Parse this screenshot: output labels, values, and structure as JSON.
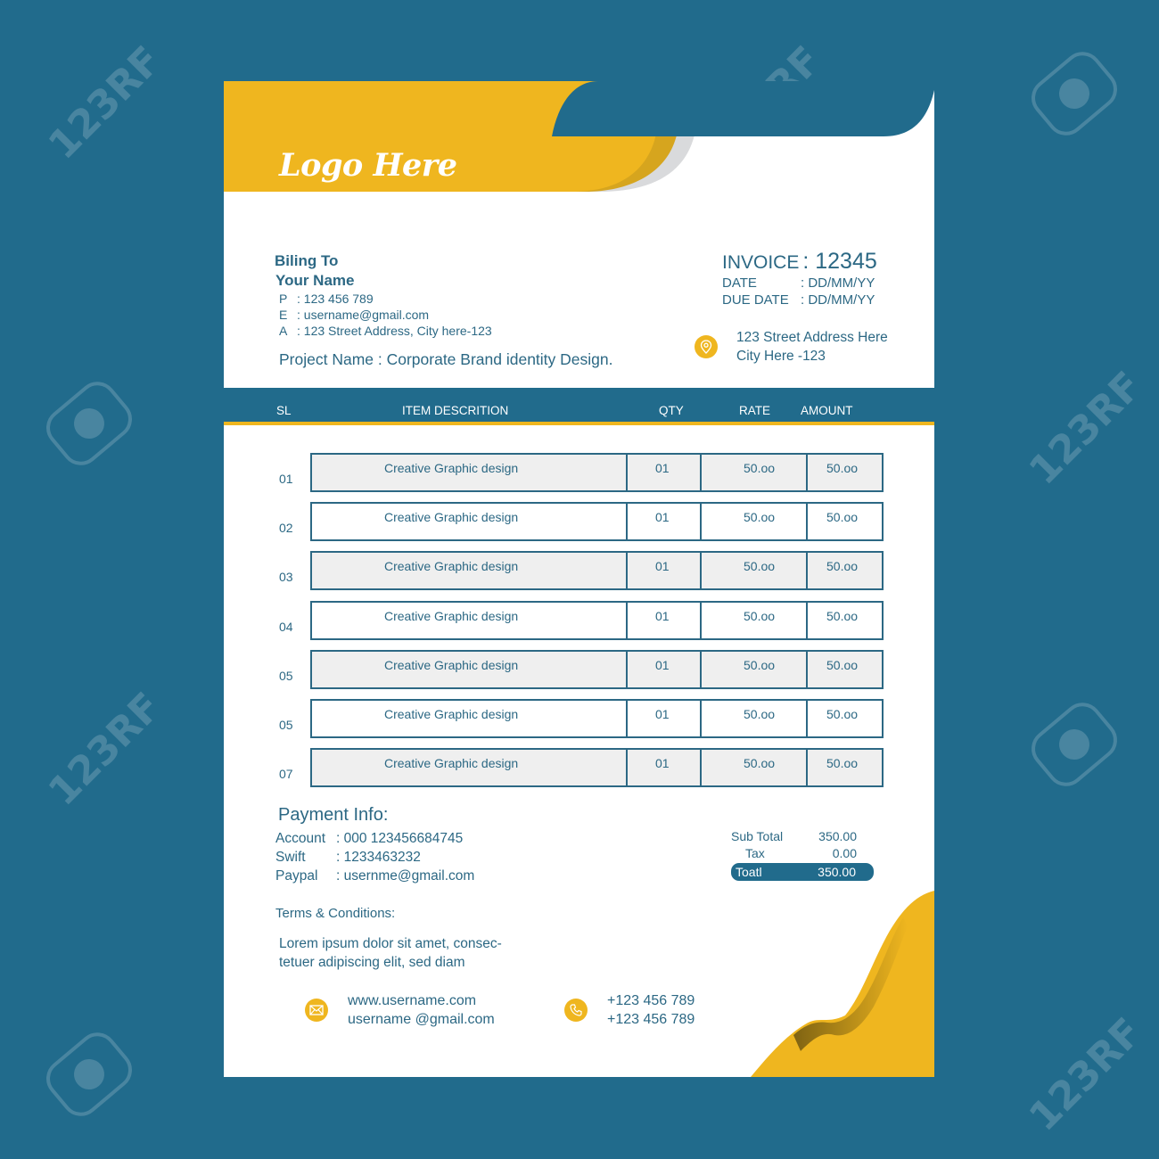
{
  "colors": {
    "primary": "#216b8c",
    "accent": "#efb61f",
    "text": "#2c6884",
    "row_shade": "#efefef"
  },
  "watermark": "123RF",
  "header": {
    "logo_text": "Logo Here"
  },
  "billing": {
    "heading": "Biling To",
    "name": "Your Name",
    "fields": [
      {
        "key": "P",
        "value": ": 123 456 789"
      },
      {
        "key": "E",
        "value": ":  username@gmail.com"
      },
      {
        "key": "A",
        "value": ": 123 Street Address, City here-123"
      }
    ],
    "project": "Project Name : Corporate Brand identity Design."
  },
  "invoice": {
    "label": "INVOICE",
    "number": ": 12345",
    "date_label": "DATE",
    "date_value": ": DD/MM/YY",
    "due_label": "DUE DATE",
    "due_value": ": DD/MM/YY"
  },
  "company_address": {
    "icon": "location-pin-icon",
    "line1": "123 Street Address Here",
    "line2": "City Here -123"
  },
  "table": {
    "headers": {
      "sl": "SL",
      "description": "ITEM DESCRITION",
      "qty": "QTY",
      "rate": "RATE",
      "amount": "AMOUNT"
    },
    "rows": [
      {
        "sl": "01",
        "description": "Creative Graphic design",
        "qty": "01",
        "rate": "50.oo",
        "amount": "50.oo"
      },
      {
        "sl": "02",
        "description": "Creative Graphic design",
        "qty": "01",
        "rate": "50.oo",
        "amount": "50.oo"
      },
      {
        "sl": "03",
        "description": "Creative Graphic design",
        "qty": "01",
        "rate": "50.oo",
        "amount": "50.oo"
      },
      {
        "sl": "04",
        "description": "Creative Graphic design",
        "qty": "01",
        "rate": "50.oo",
        "amount": "50.oo"
      },
      {
        "sl": "05",
        "description": "Creative Graphic design",
        "qty": "01",
        "rate": "50.oo",
        "amount": "50.oo"
      },
      {
        "sl": "05",
        "description": "Creative Graphic design",
        "qty": "01",
        "rate": "50.oo",
        "amount": "50.oo"
      },
      {
        "sl": "07",
        "description": "Creative Graphic design",
        "qty": "01",
        "rate": "50.oo",
        "amount": "50.oo"
      }
    ]
  },
  "payment": {
    "heading": "Payment Info:",
    "fields": [
      {
        "key": "Account",
        "value": ": 000 123456684745"
      },
      {
        "key": "Swift",
        "value": ": 1233463232"
      },
      {
        "key": "Paypal",
        "value": ": usernme@gmail.com"
      }
    ]
  },
  "totals": {
    "subtotal_label": "Sub Total",
    "subtotal_value": "350.00",
    "tax_label": "Tax",
    "tax_value": "0.00",
    "total_label": "Toatl",
    "total_value": "350.00"
  },
  "terms": {
    "heading": "Terms & Conditions:",
    "line1": "Lorem ipsum dolor sit amet, consec-",
    "line2": "tetuer adipiscing elit, sed diam"
  },
  "footer": {
    "web_icon": "envelope-icon",
    "website": "www.username.com",
    "email": "username @gmail.com",
    "phone_icon": "phone-icon",
    "phone1": "+123 456 789",
    "phone2": "+123 456 789"
  }
}
